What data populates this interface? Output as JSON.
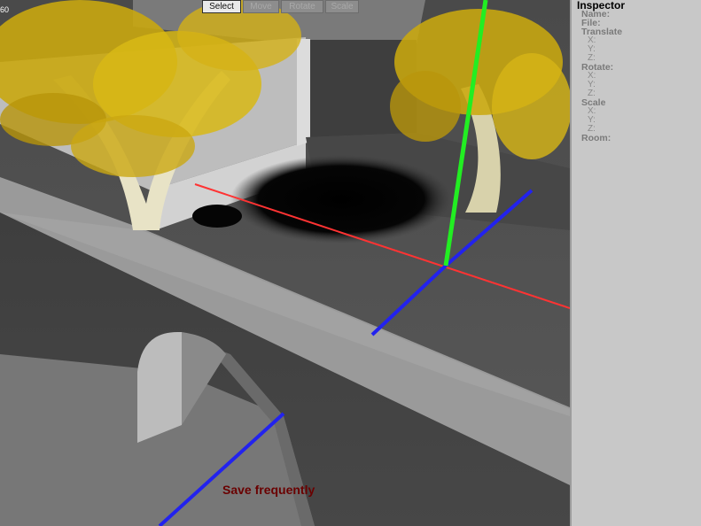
{
  "viewport": {
    "fps": "60",
    "toolbar": [
      {
        "label": "Select",
        "active": true
      },
      {
        "label": "Move",
        "active": false
      },
      {
        "label": "Rotate",
        "active": false
      },
      {
        "label": "Scale",
        "active": false
      }
    ],
    "hint": "Save frequently",
    "axis_colors": {
      "x": "#ff3333",
      "y": "#22ee22",
      "z": "#2222ee"
    }
  },
  "inspector": {
    "title": "Inspector",
    "name_label": "Name:",
    "file_label": "File:",
    "translate_label": "Translate",
    "translate_x": "X:",
    "translate_y": "Y:",
    "translate_z": "Z:",
    "rotate_label": "Rotate:",
    "rotate_x": "X:",
    "rotate_y": "Y:",
    "rotate_z": "Z:",
    "scale_label": "Scale",
    "scale_x": "X:",
    "scale_y": "Y:",
    "scale_z": "Z:",
    "room_label": "Room:"
  }
}
